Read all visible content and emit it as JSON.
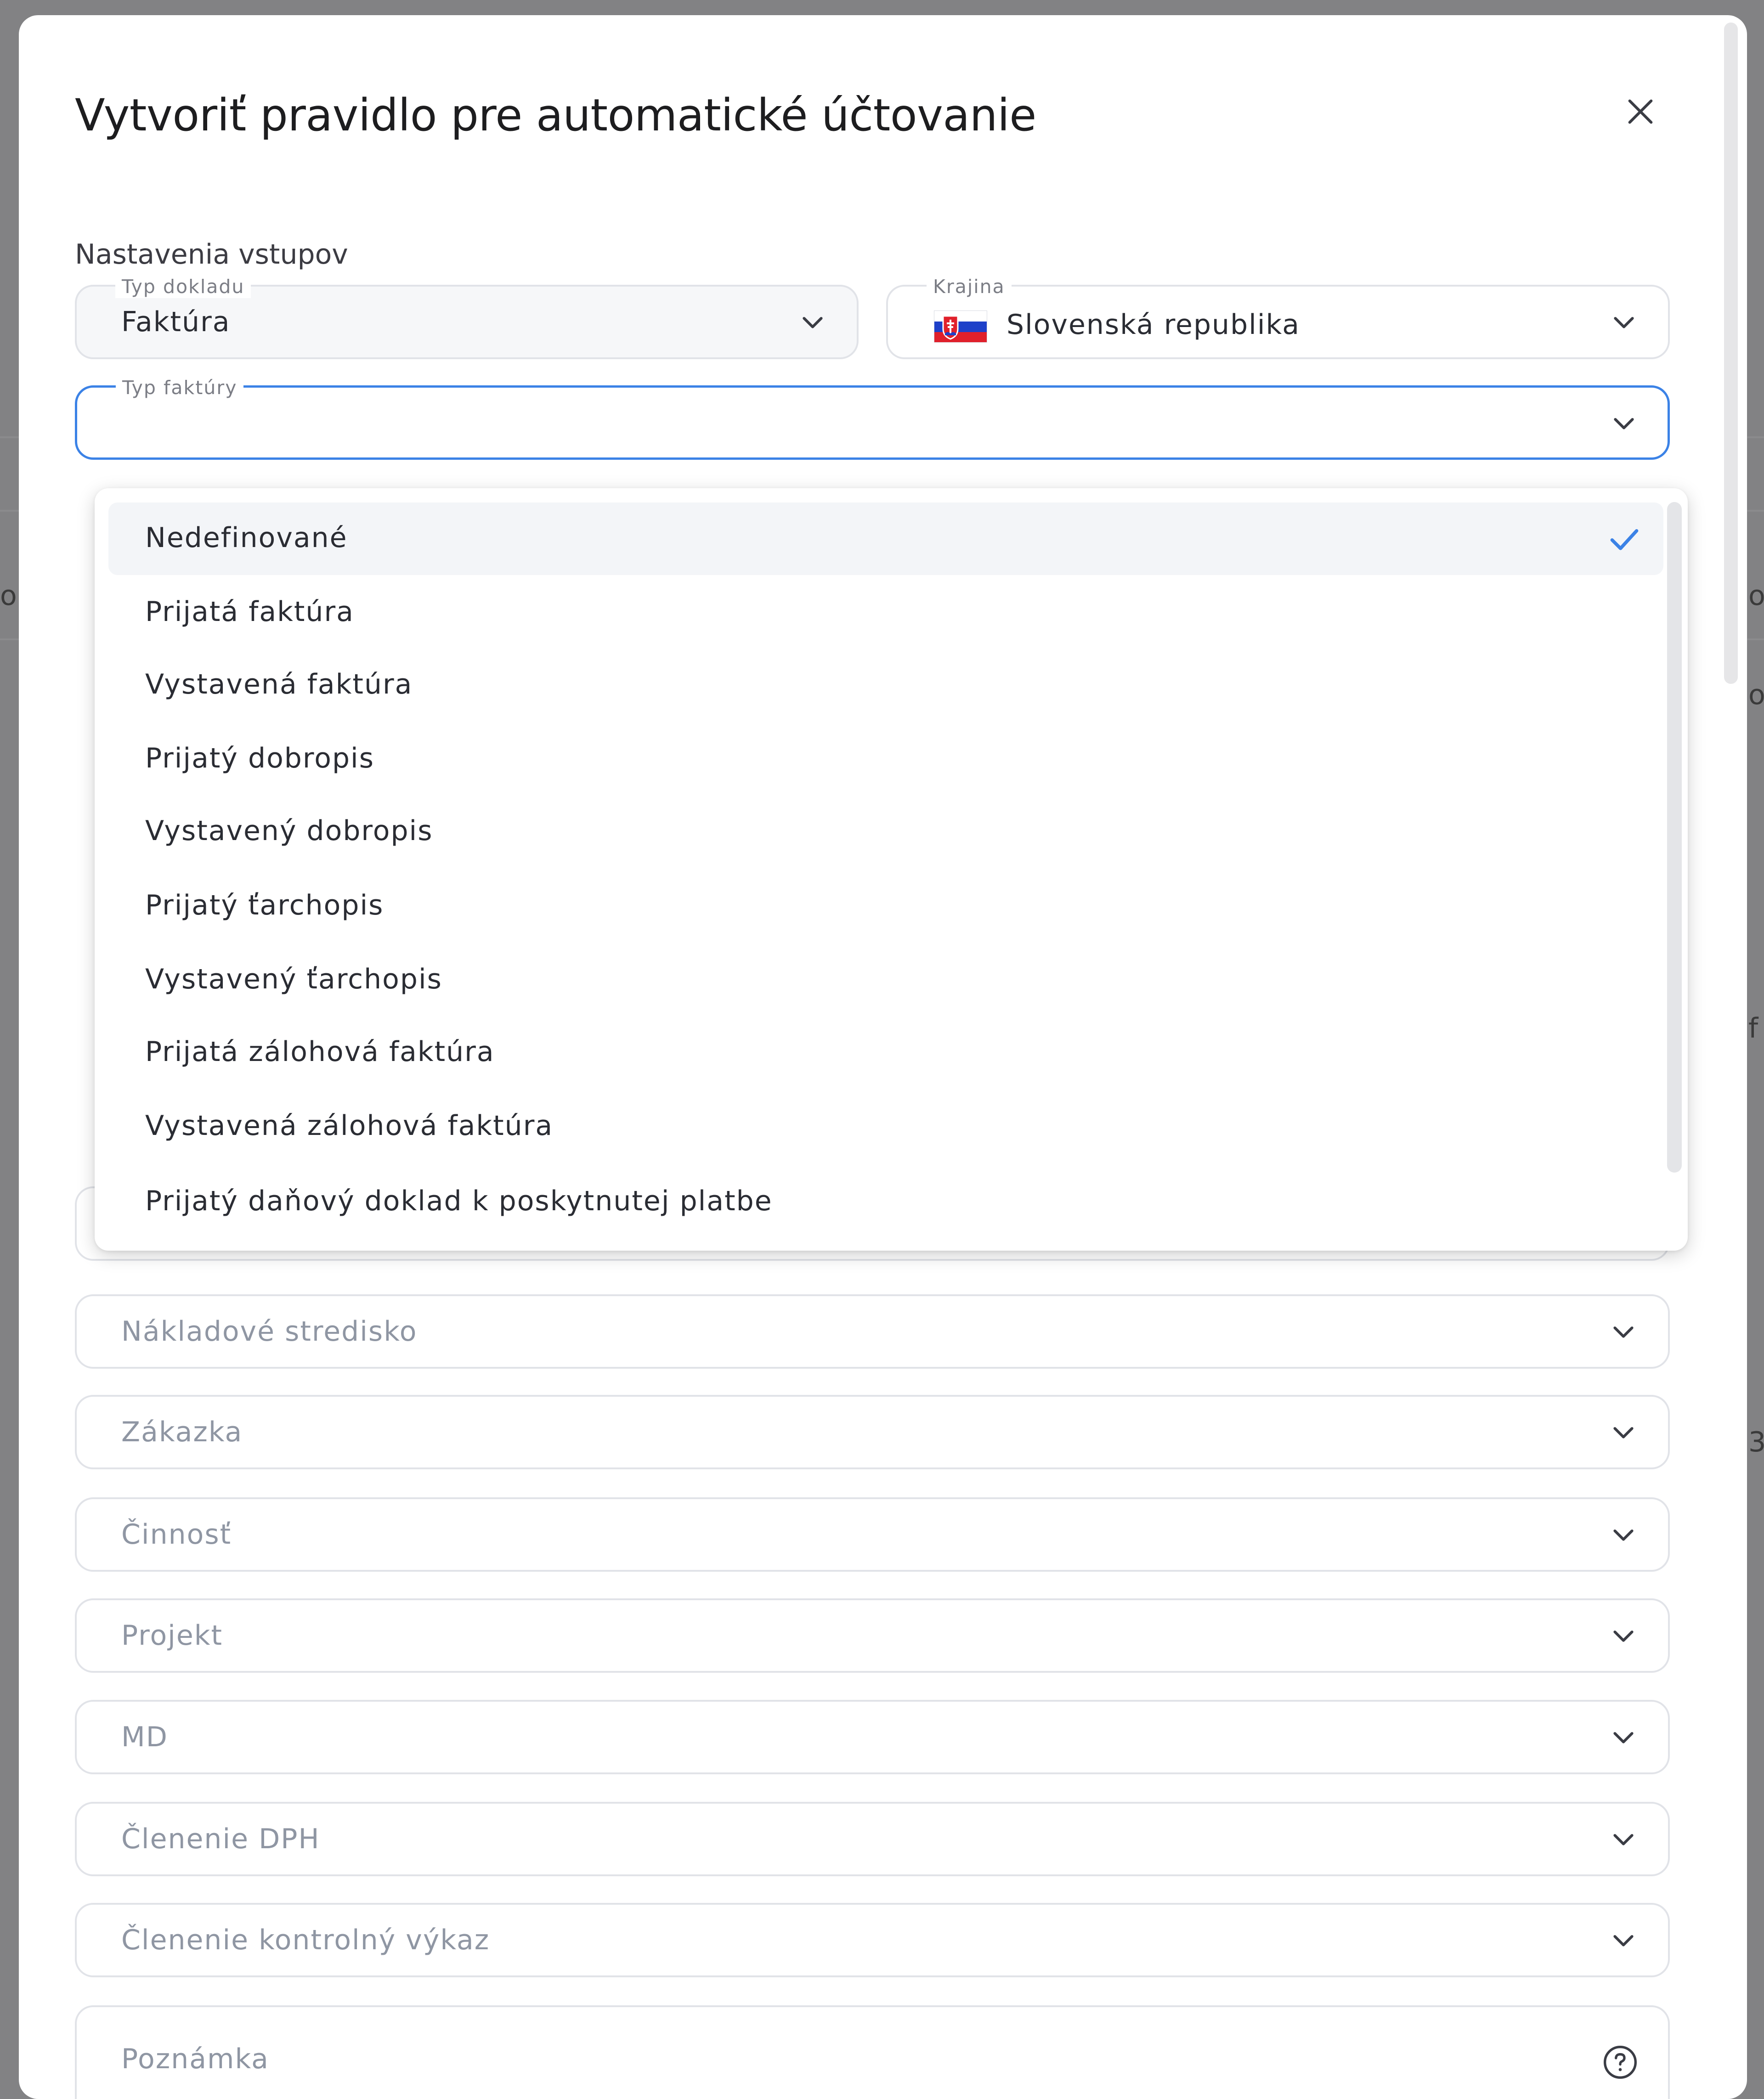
{
  "modal": {
    "title": "Vytvoriť pravidlo pre automatické účtovanie"
  },
  "background": {
    "peek_texts": [
      "ol",
      "oz",
      "oc",
      "f",
      "3"
    ]
  },
  "section": {
    "label": "Nastavenia vstupov"
  },
  "fields": {
    "document_type": {
      "legend": "Typ dokladu",
      "value": "Faktúra"
    },
    "country": {
      "legend": "Krajina",
      "value": "Slovenská republika",
      "flag": "slovakia-flag-icon"
    },
    "invoice_type": {
      "legend": "Typ faktúry",
      "value": ""
    },
    "cost_center": {
      "placeholder": "Nákladové stredisko"
    },
    "order": {
      "placeholder": "Zákazka"
    },
    "activity": {
      "placeholder": "Činnosť"
    },
    "project": {
      "placeholder": "Projekt"
    },
    "md": {
      "placeholder": "MD"
    },
    "vat_breakdown": {
      "placeholder": "Členenie DPH"
    },
    "control_statement": {
      "placeholder": "Členenie kontrolný výkaz"
    },
    "note": {
      "placeholder": "Poznámka"
    }
  },
  "dropdown": {
    "items": [
      {
        "label": "Nedefinované",
        "selected": true
      },
      {
        "label": "Prijatá faktúra"
      },
      {
        "label": "Vystavená faktúra"
      },
      {
        "label": "Prijatý dobropis"
      },
      {
        "label": "Vystavený dobropis"
      },
      {
        "label": "Prijatý ťarchopis"
      },
      {
        "label": "Vystavený ťarchopis"
      },
      {
        "label": "Prijatá zálohová faktúra"
      },
      {
        "label": "Vystavená zálohová faktúra"
      },
      {
        "label": "Prijatý daňový doklad k poskytnutej platbe"
      }
    ]
  },
  "colors": {
    "accent": "#3b82e6",
    "border": "#e1e3e8",
    "placeholder": "#8f96a3"
  }
}
